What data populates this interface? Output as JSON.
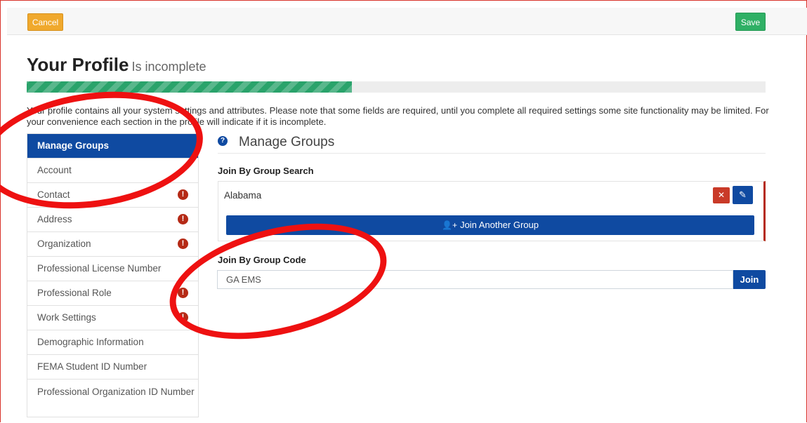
{
  "header": {
    "cancel_label": "Cancel",
    "save_label": "Save"
  },
  "page": {
    "title": "Your Profile",
    "status": "Is incomplete"
  },
  "progress": {
    "percent": 44,
    "color": "#2aa36b"
  },
  "intro_text": "Your profile contains all your system settings and attributes. Please note that some fields are required, until you complete all required settings some site functionality may be limited. For your convenience each section in the profile will indicate if it is incomplete.",
  "sidebar": {
    "items": [
      {
        "label": "Manage Groups",
        "incomplete": false,
        "active": true
      },
      {
        "label": "Account",
        "incomplete": false
      },
      {
        "label": "Contact",
        "incomplete": true
      },
      {
        "label": "Address",
        "incomplete": true
      },
      {
        "label": "Organization",
        "incomplete": true
      },
      {
        "label": "Professional License Number",
        "incomplete": false
      },
      {
        "label": "Professional Role",
        "incomplete": true
      },
      {
        "label": "Work Settings",
        "incomplete": true
      },
      {
        "label": "Demographic Information",
        "incomplete": false
      },
      {
        "label": "FEMA Student ID Number",
        "incomplete": false
      },
      {
        "label": "Professional Organization ID Number",
        "incomplete": false
      }
    ]
  },
  "main": {
    "section_title": "Manage Groups",
    "help_icon": "question-circle-icon",
    "group_search": {
      "label": "Join By Group Search",
      "groups": [
        {
          "name": "Alabama"
        }
      ],
      "join_another_label": "Join Another Group"
    },
    "group_code": {
      "label": "Join By Group Code",
      "value": "GA EMS",
      "join_label": "Join"
    }
  },
  "colors": {
    "primary": "#0f4aa1",
    "cancel": "#f0a92d",
    "save": "#2fb065",
    "alert": "#b52a16",
    "annotation": "#ee1111"
  }
}
